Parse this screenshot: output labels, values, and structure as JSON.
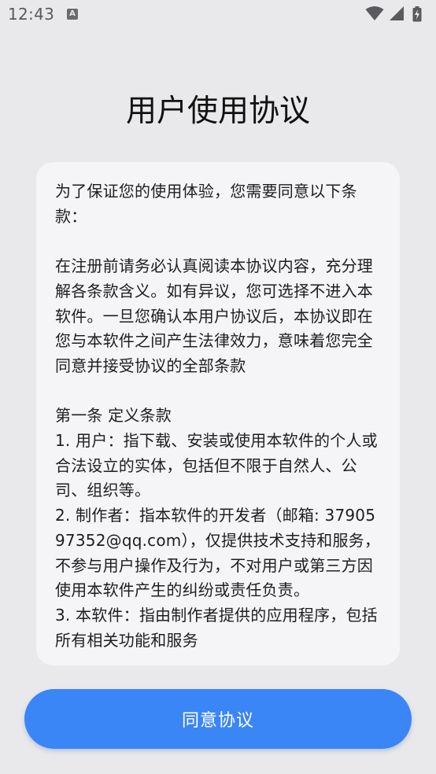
{
  "status": {
    "time": "12:43",
    "notification_glyph": "A",
    "icons": [
      "wifi-icon",
      "cell-signal-icon",
      "battery-charging-icon"
    ]
  },
  "title": "用户使用协议",
  "agreement": {
    "intro": "为了保证您的使用体验，您需要同意以下条款：",
    "notice": "在注册前请务必认真阅读本协议内容，充分理解各条款含义。如有异议，您可选择不进入本软件。一旦您确认本用户协议后，本协议即在您与本软件之间产生法律效力，意味着您完全同意并接受协议的全部条款",
    "section1_title": "第一条 定义条款",
    "def1": "1. 用户：指下载、安装或使用本软件的个人或合法设立的实体，包括但不限于自然人、公司、组织等。",
    "def2": "2. 制作者：指本软件的开发者（邮箱: 3790597352@qq.com），仅提供技术支持和服务，不参与用户操作及行为，不对用户或第三方因使用本软件产生的纠纷或责任负责。",
    "def3": "3. 本软件：指由制作者提供的应用程序，包括所有相关功能和服务"
  },
  "buttons": {
    "agree": "同意协议"
  },
  "colors": {
    "background": "#e9e9eb",
    "card": "#f5f5f7",
    "accent": "#3b86f6"
  }
}
